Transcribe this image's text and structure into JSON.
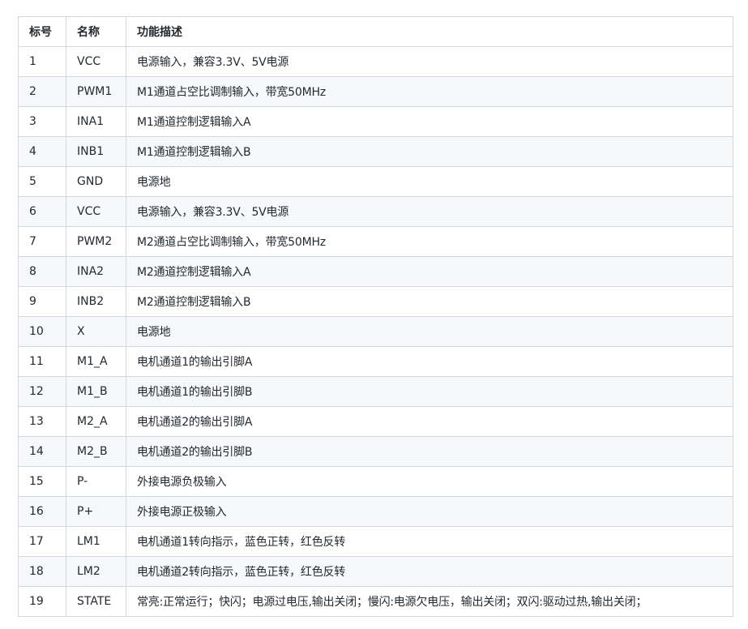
{
  "table": {
    "headers": [
      "标号",
      "名称",
      "功能描述"
    ],
    "rows": [
      [
        "1",
        "VCC",
        "电源输入，兼容3.3V、5V电源"
      ],
      [
        "2",
        "PWM1",
        "M1通道占空比调制输入，带宽50MHz"
      ],
      [
        "3",
        "INA1",
        "M1通道控制逻辑输入A"
      ],
      [
        "4",
        "INB1",
        "M1通道控制逻辑输入B"
      ],
      [
        "5",
        "GND",
        "电源地"
      ],
      [
        "6",
        "VCC",
        "电源输入，兼容3.3V、5V电源"
      ],
      [
        "7",
        "PWM2",
        "M2通道占空比调制输入，带宽50MHz"
      ],
      [
        "8",
        "INA2",
        "M2通道控制逻辑输入A"
      ],
      [
        "9",
        "INB2",
        "M2通道控制逻辑输入B"
      ],
      [
        "10",
        "X",
        "电源地"
      ],
      [
        "11",
        "M1_A",
        "电机通道1的输出引脚A"
      ],
      [
        "12",
        "M1_B",
        "电机通道1的输出引脚B"
      ],
      [
        "13",
        "M2_A",
        "电机通道2的输出引脚A"
      ],
      [
        "14",
        "M2_B",
        "电机通道2的输出引脚B"
      ],
      [
        "15",
        "P-",
        "外接电源负极输入"
      ],
      [
        "16",
        "P+",
        "外接电源正极输入"
      ],
      [
        "17",
        "LM1",
        "电机通道1转向指示，蓝色正转，红色反转"
      ],
      [
        "18",
        "LM2",
        "电机通道2转向指示，蓝色正转，红色反转"
      ],
      [
        "19",
        "STATE",
        "常亮:正常运行；快闪；电源过电压,输出关闭；慢闪:电源欠电压，输出关闭；双闪:驱动过热,输出关闭；"
      ]
    ]
  }
}
